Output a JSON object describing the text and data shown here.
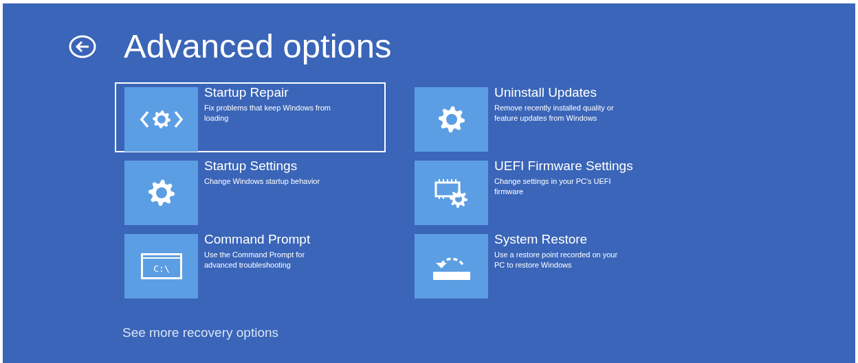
{
  "title": "Advanced options",
  "columns": [
    [
      {
        "title": "Startup Repair",
        "description": "Fix problems that keep Windows from loading",
        "kind": "repair",
        "selected": true
      },
      {
        "title": "Startup Settings",
        "description": "Change Windows startup behavior",
        "kind": "gear",
        "selected": false
      },
      {
        "title": "Command Prompt",
        "description": "Use the Command Prompt for advanced troubleshooting",
        "kind": "terminal",
        "icon_text": "C:\\",
        "selected": false
      }
    ],
    [
      {
        "title": "Uninstall Updates",
        "description": "Remove recently installed quality or feature updates from Windows",
        "kind": "gear",
        "selected": false
      },
      {
        "title": "UEFI Firmware Settings",
        "description": "Change settings in your PC's UEFI firmware",
        "kind": "firmware",
        "selected": false
      },
      {
        "title": "System Restore",
        "description": "Use a restore point recorded on your PC to restore Windows",
        "kind": "restore",
        "selected": false
      }
    ]
  ],
  "more_link": "See more recovery options"
}
